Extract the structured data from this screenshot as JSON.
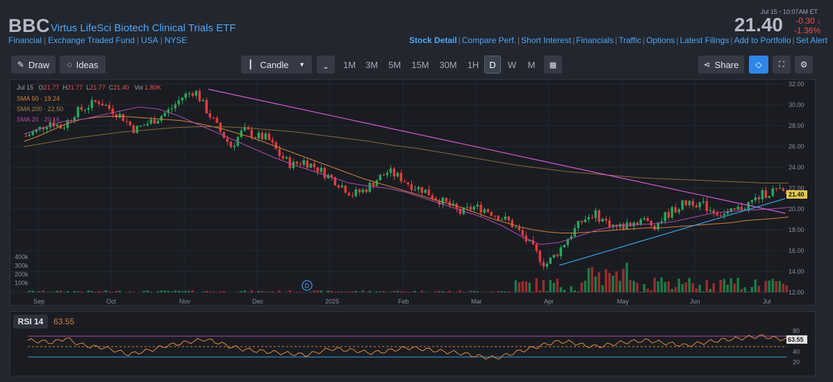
{
  "header": {
    "ticker": "BBC",
    "name": "Virtus LifeSci Biotech Clinical Trials ETF",
    "crumbs": [
      "Financial",
      "Exchange Traded Fund",
      "USA",
      "NYSE"
    ],
    "date": "Jul 15",
    "time": "10:07AM ET",
    "price": "21.40",
    "change": "-0.30",
    "change_pct": "-1.36%",
    "links": [
      "Stock Detail",
      "Compare Perf.",
      "Short Interest",
      "Financials",
      "Traffic",
      "Options",
      "Latest Filings",
      "Add to Portfolio",
      "Set Alert"
    ]
  },
  "toolbar": {
    "draw": "Draw",
    "ideas": "Ideas",
    "chart_type": "Candle",
    "timeframes": [
      "1M",
      "3M",
      "5M",
      "15M",
      "30M",
      "1H",
      "D",
      "W",
      "M"
    ],
    "active_timeframe": "D",
    "share": "Share"
  },
  "legend": {
    "date": "Jul 15",
    "o_label": "O",
    "o": "21.77",
    "h_label": "H",
    "h": "21.77",
    "l_label": "L",
    "l": "21.77",
    "c_label": "C",
    "c": "21.40",
    "vol_label": "Vol",
    "vol": "1.80K",
    "sma50": "SMA 50",
    "sma50_val": "19.24",
    "sma200": "SMA 200",
    "sma200_val": "22.50",
    "sma20": "SMA 20",
    "sma20_val": "20.16"
  },
  "price_axis": [
    "32.00",
    "30.00",
    "28.00",
    "26.00",
    "24.00",
    "22.00",
    "20.00",
    "18.00",
    "16.00",
    "14.00",
    "12.00"
  ],
  "price_tag": "21.40",
  "volume_axis": [
    "400k",
    "300k",
    "200k",
    "100k"
  ],
  "months": [
    "Sep",
    "Oct",
    "Nov",
    "Dec",
    "2025",
    "Feb",
    "Mar",
    "Apr",
    "May",
    "Jun",
    "Jul"
  ],
  "dividend_marker": "D",
  "rsi": {
    "label": "RSI 14",
    "value": "63.55",
    "axis": [
      "80",
      "60",
      "40",
      "20"
    ],
    "tag": "63.55"
  },
  "colors": {
    "up": "#26a65b",
    "down": "#e03c3c",
    "sma50": "#d4823c",
    "sma200": "#8a6a3a",
    "sma20": "#b04aa8",
    "trend_down": "#d85ad8",
    "trend_up": "#3aa0e0",
    "rsi_line": "#e08a3c"
  },
  "chart_data": {
    "type": "candlestick",
    "ylim": [
      12,
      32
    ],
    "series": [
      {
        "name": "Price",
        "values": [
          27.0,
          27.6,
          28.4,
          27.8,
          29.2,
          29.8,
          30.4,
          29.6,
          28.8,
          27.6,
          28.2,
          28.8,
          29.6,
          30.8,
          31.4,
          29.4,
          27.6,
          26.0,
          27.6,
          27.0,
          26.8,
          25.2,
          24.2,
          24.6,
          24.0,
          23.2,
          22.4,
          21.4,
          21.8,
          22.8,
          23.6,
          23.0,
          22.2,
          21.8,
          21.0,
          20.4,
          19.6,
          20.2,
          20.0,
          19.4,
          18.8,
          17.6,
          16.2,
          14.6,
          15.8,
          17.4,
          18.8,
          19.6,
          18.8,
          18.2,
          18.6,
          19.0,
          18.4,
          19.4,
          20.2,
          20.8,
          20.4,
          19.8,
          19.4,
          20.0,
          20.6,
          21.4,
          21.8,
          21.4
        ]
      },
      {
        "name": "SMA 50",
        "values": [
          26.5,
          27.0,
          27.6,
          28.2,
          28.6,
          28.8,
          28.9,
          28.9,
          28.8,
          28.7,
          28.6,
          28.5,
          28.3,
          28.0,
          27.7,
          27.3,
          26.9,
          26.4,
          25.9,
          25.4,
          24.9,
          24.4,
          23.9,
          23.4,
          22.9,
          22.5,
          22.1,
          21.7,
          21.3,
          20.9,
          20.5,
          20.1,
          19.6,
          19.1,
          18.7,
          18.3,
          18.0,
          17.8,
          17.7,
          17.7,
          17.8,
          17.9,
          18.0,
          18.1,
          18.2,
          18.2,
          18.3,
          18.4,
          18.5,
          18.6,
          18.7,
          18.9,
          19.0,
          19.1,
          19.24
        ]
      },
      {
        "name": "SMA 200",
        "values": [
          26.0,
          26.4,
          26.8,
          27.1,
          27.4,
          27.6,
          27.8,
          27.9,
          27.9,
          27.8,
          27.6,
          27.4,
          27.1,
          26.8,
          26.5,
          26.1,
          25.8,
          25.4,
          25.0,
          24.6,
          24.2,
          23.9,
          23.6,
          23.4,
          23.2,
          23.0,
          22.9,
          22.8,
          22.7,
          22.6,
          22.5,
          22.5
        ]
      },
      {
        "name": "SMA 20",
        "values": [
          27.2,
          27.8,
          28.4,
          28.6,
          29.0,
          29.4,
          29.8,
          29.6,
          29.0,
          28.2,
          27.4,
          26.6,
          25.8,
          25.0,
          24.3,
          23.7,
          23.1,
          22.5,
          22.2,
          22.0,
          21.6,
          21.0,
          20.4,
          19.8,
          19.2,
          18.4,
          17.4,
          16.6,
          16.8,
          17.4,
          18.0,
          18.4,
          18.5,
          18.6,
          18.8,
          19.2,
          19.6,
          19.8,
          19.9,
          20.0,
          20.16
        ]
      }
    ],
    "rsi_values": [
      62,
      60,
      58,
      66,
      55,
      50,
      48,
      42,
      35,
      40,
      45,
      52,
      56,
      60,
      64,
      58,
      50,
      45,
      42,
      40,
      38,
      36,
      34,
      40,
      46,
      44,
      42,
      38,
      40,
      44,
      48,
      46,
      43,
      40,
      38,
      34,
      30,
      28,
      35,
      42,
      48,
      55,
      60,
      58,
      52,
      50,
      54,
      58,
      60,
      62,
      58,
      55,
      52,
      56,
      60,
      63,
      65,
      68,
      70,
      66,
      63.55
    ]
  }
}
